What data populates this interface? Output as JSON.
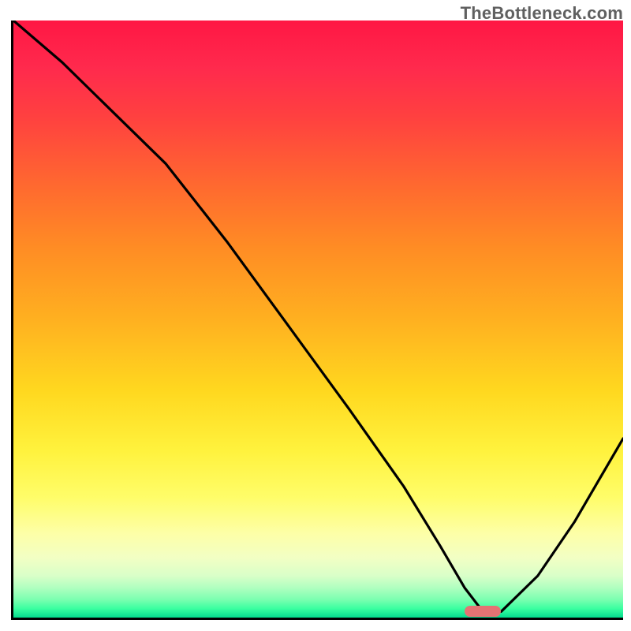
{
  "watermark": "TheBottleneck.com",
  "chart_data": {
    "type": "line",
    "title": "",
    "xlabel": "",
    "ylabel": "",
    "xlim": [
      0,
      100
    ],
    "ylim": [
      0,
      100
    ],
    "grid": false,
    "legend": false,
    "series": [
      {
        "name": "bottleneck-curve",
        "x": [
          0,
          8,
          18,
          25,
          35,
          45,
          55,
          64,
          70,
          74,
          77,
          80,
          86,
          92,
          100
        ],
        "y": [
          100,
          93,
          83,
          76,
          63,
          49,
          35,
          22,
          12,
          5,
          1,
          1,
          7,
          16,
          30
        ]
      }
    ],
    "marker": {
      "name": "optimal-range",
      "x_start": 74,
      "x_end": 80,
      "y": 1,
      "color": "#e57373"
    },
    "gradient_palette": {
      "top": "#ff1744",
      "mid": "#ffd81f",
      "bottom": "#04db8e"
    }
  }
}
